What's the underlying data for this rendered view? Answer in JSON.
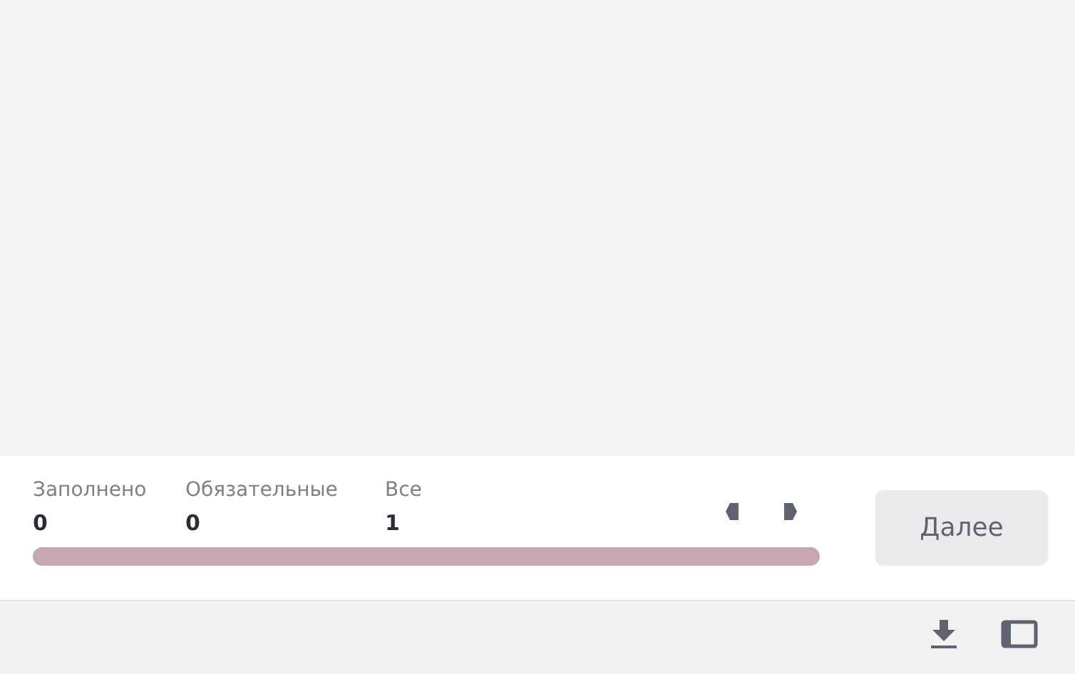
{
  "stats": [
    {
      "label": "Заполнено",
      "value": "0"
    },
    {
      "label": "Обязательные",
      "value": "0"
    },
    {
      "label": "Все",
      "value": "1"
    }
  ],
  "progress": {
    "level": 0
  },
  "next_button": {
    "label": "Далее"
  }
}
